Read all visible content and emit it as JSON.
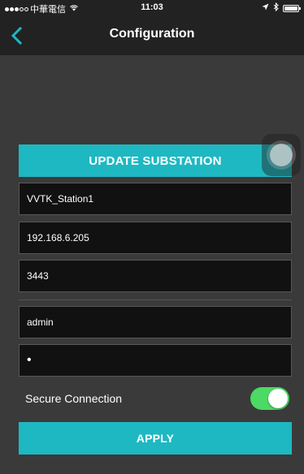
{
  "status_bar": {
    "carrier": "中華電信",
    "time": "11:03",
    "signal_bars_filled": 3,
    "signal_bars_total": 5,
    "icons": [
      "wifi-icon",
      "location-arrow-icon",
      "bluetooth-icon",
      "battery-icon"
    ],
    "battery_level": 1.0
  },
  "nav": {
    "title": "Configuration",
    "back_icon": "chevron-left-icon",
    "accent_color": "#1eb8c2"
  },
  "actions": {
    "update_label": "UPDATE SUBSTATION",
    "apply_label": "APPLY"
  },
  "form": {
    "station_name": "VVTK_Station1",
    "ip_address": "192.168.6.205",
    "port": "3443",
    "username": "admin",
    "password_mask": "•",
    "secure_label": "Secure Connection",
    "secure_enabled": true,
    "toggle_color": "#4cd964"
  }
}
